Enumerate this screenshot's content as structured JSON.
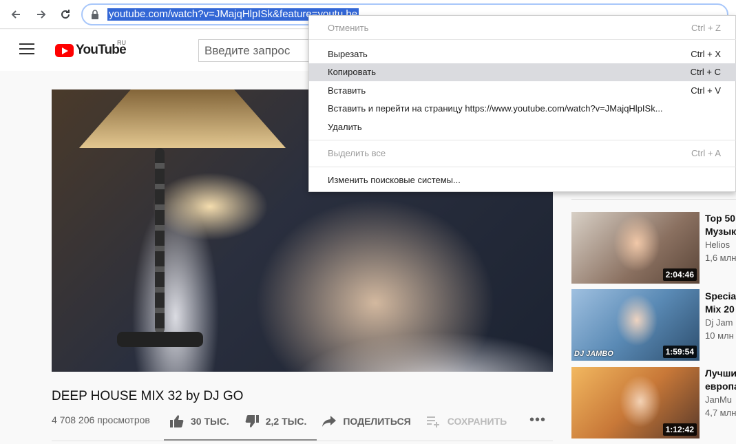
{
  "browser": {
    "url": "youtube.com/watch?v=JMajqHlpISk&feature=youtu.be"
  },
  "header": {
    "logo_text": "YouTube",
    "logo_region": "RU",
    "search_placeholder": "Введите запрос"
  },
  "video": {
    "title": "DEEP HOUSE MIX 32 by DJ GO",
    "views": "4 708 206 просмотров",
    "likes": "30 ТЫС.",
    "dislikes": "2,2 ТЫС.",
    "share_label": "ПОДЕЛИТЬСЯ",
    "save_label": "СОХРАНИТЬ",
    "more_label": "•••"
  },
  "sidebar": {
    "items": [
      {
        "title_line1": "Top 50",
        "title_line2": "Музык",
        "channel": "Helios",
        "meta": "1,6 млн",
        "duration": "2:04:46",
        "tag": ""
      },
      {
        "title_line1": "Specia",
        "title_line2": "Mix 20",
        "channel": "Dj Jam",
        "meta": "10 млн",
        "duration": "1:59:54",
        "tag": "DJ JAMBO"
      },
      {
        "title_line1": "Лучши",
        "title_line2": "европа",
        "channel": "JanMu",
        "meta": "4,7 млн",
        "duration": "1:12:42",
        "tag": ""
      }
    ]
  },
  "context_menu": {
    "undo": {
      "label": "Отменить",
      "shortcut": "Ctrl + Z"
    },
    "cut": {
      "label": "Вырезать",
      "shortcut": "Ctrl + X"
    },
    "copy": {
      "label": "Копировать",
      "shortcut": "Ctrl + C"
    },
    "paste": {
      "label": "Вставить",
      "shortcut": "Ctrl + V"
    },
    "paste_go": {
      "label": "Вставить и перейти на страницу https://www.youtube.com/watch?v=JMajqHlpISk..."
    },
    "delete": {
      "label": "Удалить"
    },
    "select_all": {
      "label": "Выделить все",
      "shortcut": "Ctrl + A"
    },
    "search_engines": {
      "label": "Изменить поисковые системы..."
    }
  }
}
